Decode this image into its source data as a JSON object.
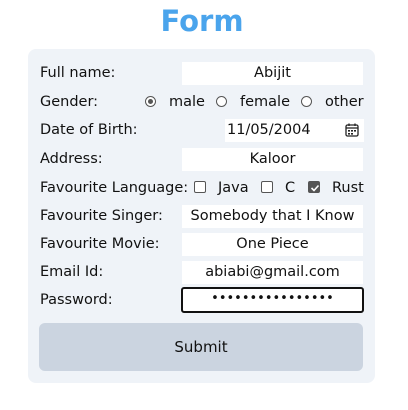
{
  "title": "Form",
  "fields": {
    "full_name": {
      "label": "Full name:",
      "value": "Abijit"
    },
    "gender": {
      "label": "Gender:",
      "options": [
        "male",
        "female",
        "other"
      ],
      "selected": "male"
    },
    "dob": {
      "label": "Date of Birth:",
      "value": "11/05/2004",
      "icon": "calendar-icon"
    },
    "address": {
      "label": "Address:",
      "value": "Kaloor"
    },
    "language": {
      "label": "Favourite Language:",
      "options": [
        "Java",
        "C",
        "Rust"
      ],
      "checked": [
        "Rust"
      ]
    },
    "singer": {
      "label": "Favourite Singer:",
      "value": "Somebody that I Know"
    },
    "movie": {
      "label": "Favourite Movie:",
      "value": "One Piece"
    },
    "email": {
      "label": "Email Id:",
      "value": "abiabi@gmail.com"
    },
    "password": {
      "label": "Password:",
      "value": "••••••••••••••••"
    }
  },
  "submit_label": "Submit",
  "colors": {
    "title": "#4aa4ec",
    "card": "#eff3f8",
    "button": "#cbd4e0"
  }
}
